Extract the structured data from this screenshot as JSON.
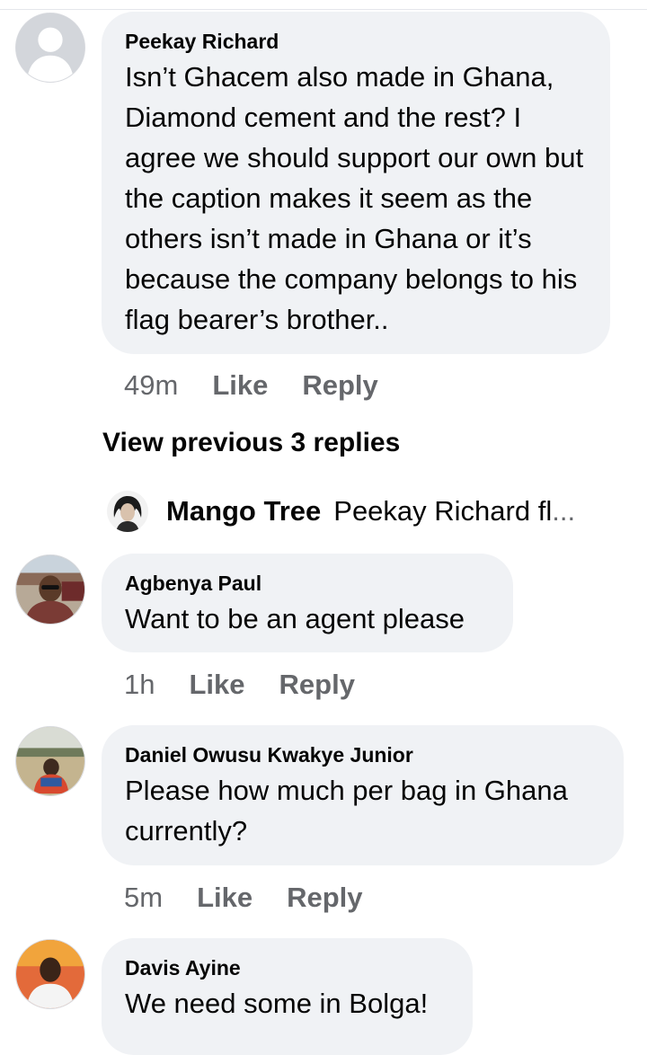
{
  "comments": [
    {
      "author": "Peekay Richard",
      "text": "Isn’t Ghacem also made in Ghana, Diamond cement and the rest? I agree we should support our own but the caption makes it seem as the others isn’t made in Ghana or it’s because the company belongs to his flag bearer’s brother..",
      "time": "49m",
      "like": "Like",
      "reply": "Reply",
      "avatar_icon": "default-profile-icon"
    },
    {
      "author": "Agbenya Paul",
      "text": "Want to be an agent please",
      "time": "1h",
      "like": "Like",
      "reply": "Reply",
      "avatar_icon": "photo-avatar"
    },
    {
      "author": "Daniel Owusu Kwakye Junior",
      "text": "Please how much per bag in Ghana currently?",
      "time": "5m",
      "like": "Like",
      "reply": "Reply",
      "avatar_icon": "photo-avatar"
    },
    {
      "author": "Davis Ayine",
      "text": "We need some in Bolga!",
      "avatar_icon": "photo-avatar"
    }
  ],
  "view_previous": "View previous 3 replies",
  "reply_preview": {
    "author": "Mango Tree",
    "text": "Peekay Richard fl",
    "ellipsis": "..."
  },
  "colors": {
    "bubble": "#f0f2f5",
    "secondary_text": "#65676b",
    "primary_text": "#050505"
  }
}
